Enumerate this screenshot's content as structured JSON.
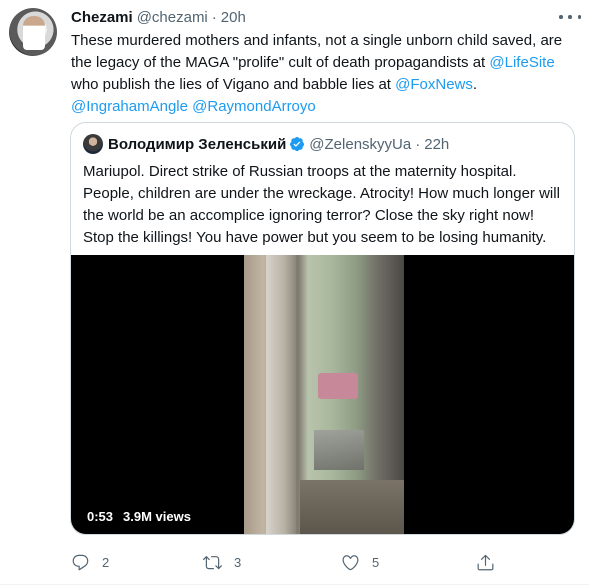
{
  "tweet": {
    "author_name": "Chezami",
    "author_handle": "@chezami",
    "separator": "·",
    "time": "20h",
    "text_part1": "These murdered mothers and infants, not a single unborn child saved, are the legacy of the MAGA \"prolife\" cult of death propagandists at ",
    "mention1": "@LifeSite",
    "text_part2": " who publish the lies of Vigano and babble lies at ",
    "mention2": "@FoxNews",
    "text_part3": ". ",
    "mention3": "@IngrahamAngle",
    "text_part4": " ",
    "mention4": "@RaymondArroyo"
  },
  "quote": {
    "author_name": "Володимир Зеленський",
    "author_handle": "@ZelenskyyUa",
    "separator": "·",
    "time": "22h",
    "text": "Mariupol. Direct strike of Russian troops at the maternity hospital. People, children are under the wreckage. Atrocity! How much longer will the world be an accomplice ignoring terror? Close the sky right now! Stop the killings! You have power but you seem to be losing humanity.",
    "video_duration": "0:53",
    "video_views": "3.9M views"
  },
  "actions": {
    "reply_count": "2",
    "retweet_count": "3",
    "like_count": "5"
  },
  "colors": {
    "link": "#1d9bf0",
    "secondary_text": "#536471",
    "border": "#cfd9de"
  },
  "icons": {
    "reply": "reply-icon",
    "retweet": "retweet-icon",
    "like": "heart-icon",
    "share": "share-icon",
    "more": "more-icon",
    "verified": "verified-badge-icon"
  }
}
